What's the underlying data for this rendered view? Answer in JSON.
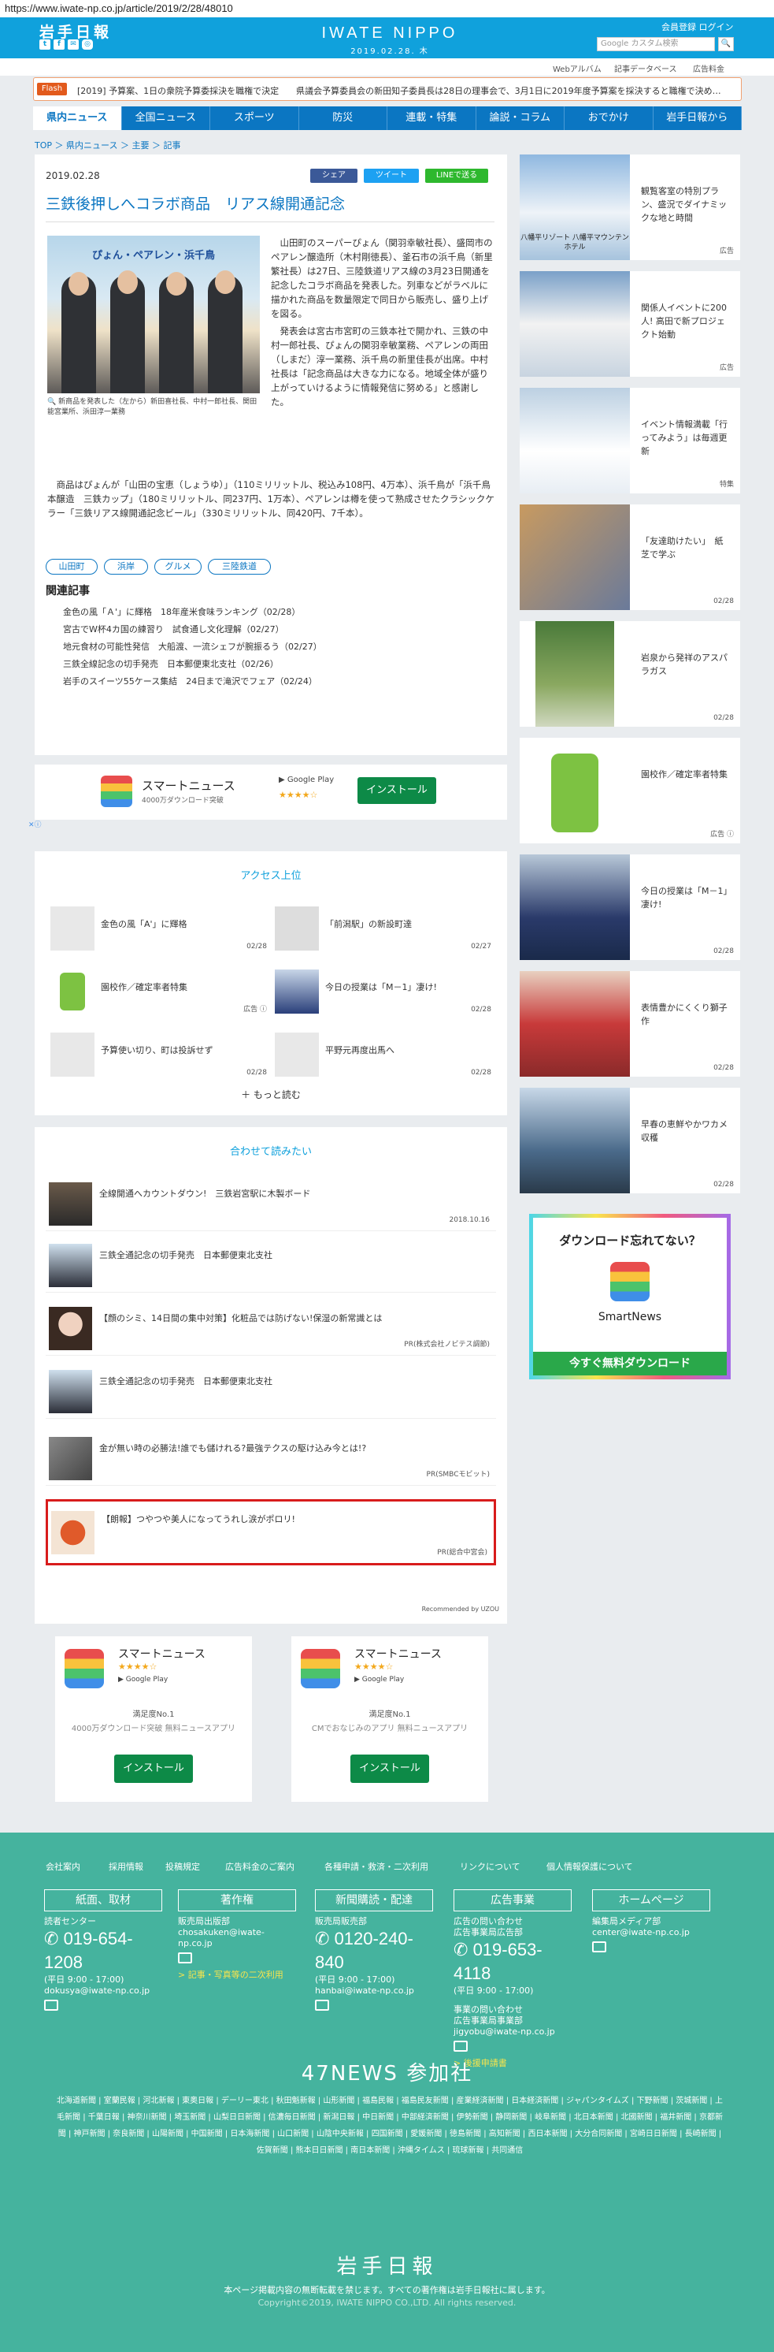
{
  "url": "https://www.iwate-np.co.jp/article/2019/2/28/48010",
  "header": {
    "logo": "岩手日報",
    "brand": "IWATE NIPPO",
    "date": "2019.02.28. 木",
    "login_links": "会員登録 ログイン",
    "search_placeholder": "Google カスタム検索",
    "social_icons": [
      "twitter-icon",
      "facebook-icon",
      "mail-icon",
      "instagram-icon"
    ]
  },
  "subnav": {
    "items": [
      "Webアルバム",
      "記事データベース",
      "広告料金"
    ]
  },
  "flash": {
    "tag": "Flash",
    "text": "[2019] 予算案、1日の衆院予算委採決を職権で決定　　県議会予算委員会の新田知子委員長は28日の理事会で、3月1日に2019年度予算案を採決すると職権で決め…"
  },
  "navbar": {
    "items": [
      "県内ニュース",
      "全国ニュース",
      "スポーツ",
      "防災",
      "連載・特集",
      "論説・コラム",
      "おでかけ",
      "岩手日報から"
    ]
  },
  "breadcrumb": "TOP ＞ 県内ニュース ＞ 主要 ＞ 記事",
  "article": {
    "date": "2019.02.28",
    "share": [
      "シェア",
      "ツイート",
      "LINEで送る"
    ],
    "title": "三鉄後押しへコラボ商品　リアス線開通記念",
    "photo_banner": "ぴょん・ペアレン・浜千鳥",
    "caption": "新商品を発表した（左から）新田喜社長、中村一郎社長、関田能宮業所、浜田淳一業務",
    "body1": "山田町のスーパーぴょん（関羽幸敏社長）、盛岡市のペアレン醸造所（木村剛徳長）、釜石市の浜千鳥（新里繁社長）は27日、三陸鉄道リアス線の3月23日開通を記念したコラボ商品を発表した。列車などがラベルに描かれた商品を数量限定で同日から販売し、盛り上げを図る。",
    "body1b": "発表会は宮古市宮町の三鉄本社で開かれ、三鉄の中村一郎社長、ぴょんの関羽幸敏業務、ペアレンの両田（しまだ）淳一業務、浜千鳥の新里佳長が出席。中村社長は「記念商品は大きな力になる。地域全体が盛り上がっていけるように情報発信に努める」と感謝した。",
    "body2": "商品はぴょんが「山田の宝恵（しょうゆ）」（110ミリリットル、税込み108円、4万本）、浜千鳥が「浜千鳥　本醸造　三鉄カップ」（180ミリリットル、同237円、1万本）、ペアレンは樽を使って熟成させたクラシックケラー「三鉄リアス線開通記念ビール」（330ミリリットル、同420円、7千本）。",
    "tags": [
      "山田町",
      "浜岸",
      "グルメ",
      "三陸鉄道"
    ],
    "related_title": "関連記事",
    "related": [
      "金色の風「Ａ'」に輝格　18年産米食味ランキング（02/28）",
      "宮古でW杯4カ国の練習り　試食通し文化理解（02/27）",
      "地元食材の可能性発信　大船渡、一流シェフが腕振るう（02/27）",
      "三鉄全線記念の切手発売　日本郵便東北支社（02/26）",
      "岩手のスイーツ55ケース集結　24日まで滝沢でフェア（02/24）"
    ]
  },
  "smartnews_ad": {
    "title": "スマートニュース",
    "sub": "4000万ダウンロード突破",
    "store": "Google Play",
    "stars": 4,
    "install": "インストール"
  },
  "access": {
    "title": "アクセス上位",
    "items": [
      {
        "title": "金色の風「A'」に輝格",
        "date": "02/28"
      },
      {
        "title": "「前潟駅」の新設町達",
        "date": "02/27"
      },
      {
        "title": "園校作／確定率者特集",
        "date": "広告 ⓘ"
      },
      {
        "title": "今日の授業は「M－1」凄け!",
        "date": "02/28"
      },
      {
        "title": "予算使い切り、町は投訴せず",
        "date": "02/28"
      },
      {
        "title": "平野元再度出馬へ",
        "date": "02/28"
      }
    ],
    "more": "もっと読む"
  },
  "recommend": {
    "title": "合わせて読みたい",
    "items": [
      {
        "title": "全線開通へカウントダウン!　三鉄岩宮駅に木製ボード",
        "sponsor": "2018.10.16"
      },
      {
        "title": "三鉄全通記念の切手発売　日本郵便東北支社",
        "sponsor": ""
      },
      {
        "title": "【顔のシミ、14日間の集中対策】化粧品では防げない!保湿の新常識とは",
        "sponsor": "PR(株式会社ノビテス調節)"
      },
      {
        "title": "三鉄全通記念の切手発売　日本郵便東北支社",
        "sponsor": ""
      },
      {
        "title": "金が無い時の必勝法!誰でも儲けれる?最強テクスの駆け込み今とは!?",
        "sponsor": "PR(SMBCモビット)"
      },
      {
        "title": "【朗報】つやつや美人になってうれし涙がポロリ!",
        "sponsor": "PR(総合中宮会)"
      }
    ],
    "powered": "Recommended by UZOU"
  },
  "ads2": [
    {
      "title": "スマートニュース",
      "store": "Google Play",
      "rank": "満足度No.1",
      "desc": "4000万ダウンロード突破 無料ニュースアプリ",
      "install": "インストール"
    },
    {
      "title": "スマートニュース",
      "store": "Google Play",
      "rank": "満足度No.1",
      "desc": "CMでおなじみのアプリ 無料ニュースアプリ",
      "install": "インストール"
    }
  ],
  "sidebar": {
    "items": [
      {
        "title": "観覧客室の特別プラン、盛況でダイナミックな地と時間",
        "label": "八幡平リゾート 八幡平マウンテンホテル",
        "date": "広告"
      },
      {
        "title": "関係人イベントに200人! 高田で新プロジェクト始動",
        "date": "広告"
      },
      {
        "title": "イベント情報満載「行ってみよう」は毎週更新",
        "date": "特集"
      },
      {
        "title": "「友達助けたい」　紙芝で学ぶ",
        "date": "02/28"
      },
      {
        "title": "岩泉から発祥のアスパラガス",
        "date": "02/28"
      },
      {
        "title": "園校作／確定率者特集",
        "date": "広告 ⓘ"
      },
      {
        "title": "今日の授業は「M－1」凄け!",
        "date": "02/28"
      },
      {
        "title": "表情豊かにくくり獅子作",
        "date": "02/28"
      },
      {
        "title": "早春の恵鮮やかワカメ収穫",
        "date": "02/28"
      }
    ]
  },
  "smartnews_side": {
    "headline": "ダウンロード忘れてない？",
    "app": "SmartNews",
    "cta": "今すぐ無料ダウンロード"
  },
  "footer": {
    "links": [
      "会社案内",
      "採用情報",
      "投稿規定",
      "広告料金のご案内",
      "各種申請・救済・二次利用",
      "リンクについて",
      "個人情報保護について"
    ],
    "boxes": [
      "紙面、取材",
      "著作権",
      "新聞購読・配達",
      "広告事業",
      "ホームページ"
    ],
    "col1": {
      "label": "読者センター",
      "phone": "019-654-1208",
      "hours": "(平日 9:00 - 17:00)",
      "email": "dokusya@iwate-np.co.jp"
    },
    "col2": {
      "label": "販売局出版部",
      "email": "chosakuken@iwate-np.co.jp",
      "link": "> 記事・写真等の二次利用"
    },
    "col3": {
      "label": "販売局販売部",
      "phone": "0120-240-840",
      "hours": "(平日 9:00 - 17:00)",
      "email": "hanbai@iwate-np.co.jp"
    },
    "col4": {
      "label": "広告の問い合わせ",
      "label2": "広告事業局広告部",
      "phone": "019-653-4118",
      "hours": "(平日 9:00 - 17:00)",
      "label3": "事業の問い合わせ",
      "label4": "広告事業局事業部",
      "email": "jigyobu@iwate-np.co.jp",
      "link": "> 後援申請書"
    },
    "col5": {
      "label": "編集局メディア部",
      "email": "center@iwate-np.co.jp"
    },
    "news47": "47NEWS 参加社",
    "papers": "北海道新聞 | 室蘭民報 | 河北新報 | 東奥日報 | デーリー東北 | 秋田魁新報 | 山形新聞 | 福島民報 | 福島民友新聞 | 産業経済新聞 | 日本経済新聞 | ジャパンタイムズ | 下野新聞 | 茨城新聞 | 上毛新聞 | 千葉日報 | 神奈川新聞 | 埼玉新聞 | 山梨日日新聞 | 信濃毎日新聞 | 新潟日報 | 中日新聞 | 中部経済新聞 | 伊勢新聞 | 静岡新聞 | 岐阜新聞 | 北日本新聞 | 北國新聞 | 福井新聞 | 京都新聞 | 神戸新聞 | 奈良新聞 | 山陽新聞 | 中国新聞 | 日本海新聞 | 山口新聞 | 山陰中央新報 | 四国新聞 | 愛媛新聞 | 徳島新聞 | 高知新聞 | 西日本新聞 | 大分合同新聞 | 宮崎日日新聞 | 長崎新聞 | 佐賀新聞 | 熊本日日新聞 | 南日本新聞 | 沖縄タイムス | 琉球新報 | 共同通信",
    "logo": "岩手日報",
    "note": "本ページ掲載内容の無断転載を禁じます。すべての著作権は岩手日報社に属します。",
    "copyright": "Copyright©2019, IWATE NIPPO CO.,LTD. All rights reserved."
  }
}
